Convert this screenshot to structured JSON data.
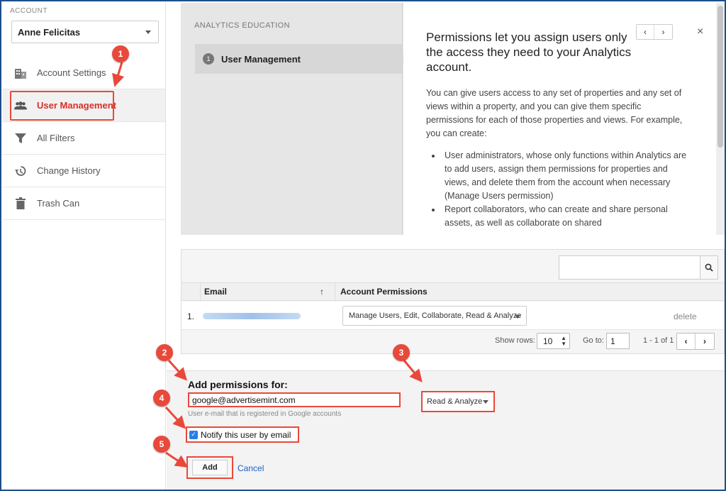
{
  "sidebar": {
    "account_label": "ACCOUNT",
    "account_name": "Anne Felicitas",
    "items": [
      {
        "label": "Account Settings",
        "icon": "building-icon"
      },
      {
        "label": "User Management",
        "icon": "users-icon",
        "active": true
      },
      {
        "label": "All Filters",
        "icon": "filter-icon"
      },
      {
        "label": "Change History",
        "icon": "history-icon"
      },
      {
        "label": "Trash Can",
        "icon": "trash-icon"
      }
    ]
  },
  "education": {
    "section_title": "ANALYTICS EDUCATION",
    "step_number": "1",
    "step_label": "User Management",
    "heading": "Permissions let you assign users only the access they need to your Analytics account.",
    "body": "You can give users access to any set of properties and any set of views within a property, and you can give them specific permissions for each of those properties and views. For example, you can create:",
    "bullets": [
      "User administrators, whose only functions within Analytics are to add users, assign them permissions for properties and views, and delete them from the account when necessary (Manage Users permission)",
      "Report collaborators, who can create and share personal assets, as well as collaborate on shared"
    ],
    "prev": "‹",
    "next": "›",
    "close": "×"
  },
  "table": {
    "columns": [
      "Email",
      "Account Permissions"
    ],
    "sort_indicator": "↑",
    "rows": [
      {
        "num": "1.",
        "permissions": "Manage Users, Edit, Collaborate, Read & Analyze",
        "action": "delete"
      }
    ],
    "show_rows_label": "Show rows:",
    "show_rows_value": "10",
    "goto_label": "Go to:",
    "goto_value": "1",
    "range": "1 - 1 of 1",
    "prev": "‹",
    "next": "›"
  },
  "add_permissions": {
    "title": "Add permissions for:",
    "email_value": "google@advertisemint.com",
    "helper": "User e-mail that is registered in Google accounts",
    "role_value": "Read & Analyze",
    "notify_label": "Notify this user by email",
    "notify_checked": true,
    "add_label": "Add",
    "cancel_label": "Cancel"
  },
  "callouts": [
    "1",
    "2",
    "3",
    "4",
    "5"
  ],
  "colors": {
    "accent_red": "#e8493a",
    "active_text": "#d93025",
    "link_blue": "#1a5fc8",
    "frame_blue": "#1f4e8c"
  }
}
